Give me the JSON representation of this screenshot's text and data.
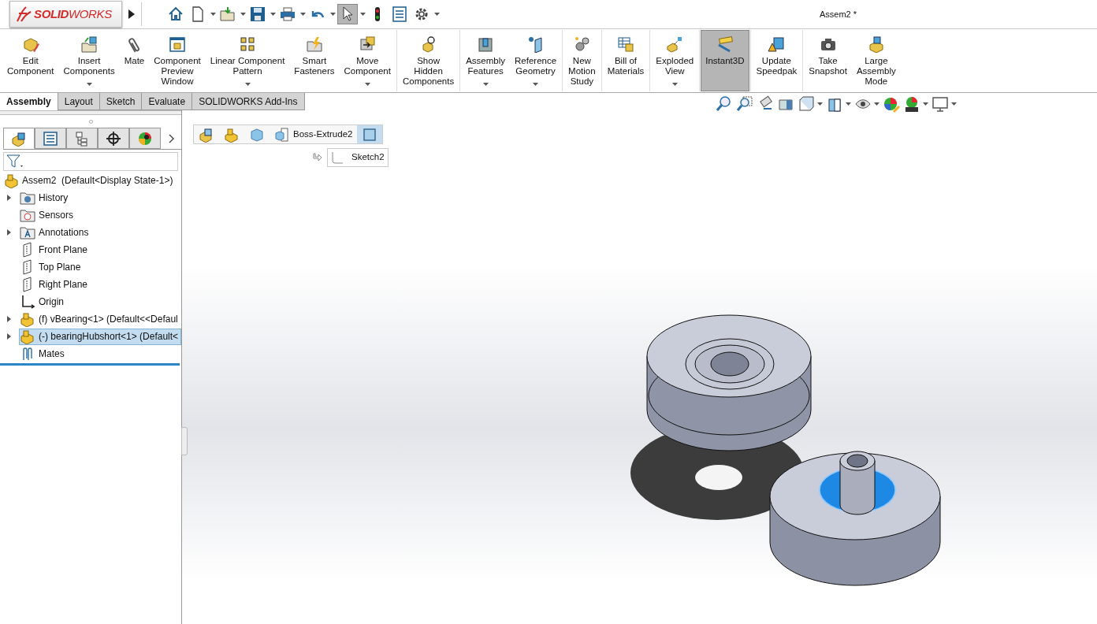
{
  "app": {
    "logo": "**SOLID**WORKS",
    "title": "Assem2 *"
  },
  "quick_tools": [
    {
      "kind": "home",
      "has_menu": false,
      "selected": false
    },
    {
      "kind": "new",
      "has_menu": true,
      "selected": false
    },
    {
      "kind": "open",
      "has_menu": true,
      "selected": false
    },
    {
      "kind": "save",
      "has_menu": true,
      "selected": false
    },
    {
      "kind": "print",
      "has_menu": true,
      "selected": false
    },
    {
      "kind": "undo",
      "has_menu": true,
      "selected": false
    },
    {
      "kind": "select",
      "has_menu": true,
      "selected": true
    },
    {
      "kind": "rebuild",
      "has_menu": false,
      "selected": false
    },
    {
      "kind": "file-properties",
      "has_menu": false,
      "selected": false
    },
    {
      "kind": "options",
      "has_menu": true,
      "selected": false
    }
  ],
  "ribbon": {
    "groups": [
      [
        {
          "label": "Edit\nComponent",
          "kind": "edit",
          "has_menu": false,
          "selected": false
        },
        {
          "label": "Insert\nComponents",
          "kind": "insert",
          "has_menu": true,
          "selected": false
        },
        {
          "label": "Mate",
          "kind": "mate",
          "has_menu": false,
          "selected": false
        },
        {
          "label": "Component\nPreview\nWindow",
          "kind": "preview",
          "has_menu": false,
          "selected": false
        },
        {
          "label": "Linear Component\nPattern",
          "kind": "pattern",
          "has_menu": true,
          "selected": false
        },
        {
          "label": "Smart\nFasteners",
          "kind": "fastener",
          "has_menu": false,
          "selected": false
        },
        {
          "label": "Move\nComponent",
          "kind": "move",
          "has_menu": true,
          "selected": false
        }
      ],
      [
        {
          "label": "Show\nHidden\nComponents",
          "kind": "show",
          "has_menu": false,
          "selected": false
        }
      ],
      [
        {
          "label": "Assembly\nFeatures",
          "kind": "feature",
          "has_menu": true,
          "selected": false
        },
        {
          "label": "Reference\nGeometry",
          "kind": "reference",
          "has_menu": true,
          "selected": false
        }
      ],
      [
        {
          "label": "New\nMotion\nStudy",
          "kind": "motion",
          "has_menu": false,
          "selected": false
        }
      ],
      [
        {
          "label": "Bill of\nMaterials",
          "kind": "bom",
          "has_menu": false,
          "selected": false
        }
      ],
      [
        {
          "label": "Exploded\nView",
          "kind": "explode",
          "has_menu": true,
          "selected": false
        }
      ],
      [
        {
          "label": "Instant3D",
          "kind": "instant3d",
          "has_menu": false,
          "selected": true
        }
      ],
      [
        {
          "label": "Update\nSpeedpak",
          "kind": "speedpak",
          "has_menu": false,
          "selected": false
        }
      ],
      [
        {
          "label": "Take\nSnapshot",
          "kind": "camera",
          "has_menu": false,
          "selected": false
        },
        {
          "label": "Large\nAssembly\nMode",
          "kind": "large",
          "has_menu": false,
          "selected": false
        }
      ]
    ]
  },
  "tabs": [
    {
      "label": "Assembly",
      "selected": true
    },
    {
      "label": "Layout",
      "selected": false
    },
    {
      "label": "Sketch",
      "selected": false
    },
    {
      "label": "Evaluate",
      "selected": false
    },
    {
      "label": "SOLIDWORKS Add-Ins",
      "selected": false
    }
  ],
  "view_tools": [
    {
      "kind": "zoom-fit",
      "has_menu": false
    },
    {
      "kind": "zoom-area",
      "has_menu": false
    },
    {
      "kind": "previous-view",
      "has_menu": false
    },
    {
      "kind": "section",
      "has_menu": false
    },
    {
      "kind": "view-orientation",
      "has_menu": true
    },
    {
      "kind": "display-style",
      "has_menu": true
    },
    {
      "kind": "hide-show",
      "has_menu": true
    },
    {
      "kind": "edit-appearance",
      "has_menu": false
    },
    {
      "kind": "scene",
      "has_menu": true
    },
    {
      "kind": "display",
      "has_menu": true
    }
  ],
  "panel_tabs": [
    {
      "kind": "tree",
      "selected": true
    },
    {
      "kind": "properties",
      "selected": false
    },
    {
      "kind": "config",
      "selected": false
    },
    {
      "kind": "dimxpert",
      "selected": false
    },
    {
      "kind": "appearance",
      "selected": false
    }
  ],
  "tree": {
    "root": {
      "label": "Assem2  (Default<Display State-1>)"
    },
    "items": [
      {
        "label": "History",
        "kind": "history",
        "expandable": true,
        "selected": false
      },
      {
        "label": "Sensors",
        "kind": "sensors",
        "expandable": false,
        "selected": false
      },
      {
        "label": "Annotations",
        "kind": "annotations",
        "expandable": true,
        "selected": false
      },
      {
        "label": "Front Plane",
        "kind": "plane",
        "expandable": false,
        "selected": false
      },
      {
        "label": "Top Plane",
        "kind": "plane",
        "expandable": false,
        "selected": false
      },
      {
        "label": "Right Plane",
        "kind": "plane",
        "expandable": false,
        "selected": false
      },
      {
        "label": "Origin",
        "kind": "origin",
        "expandable": false,
        "selected": false
      },
      {
        "label": "(f) vBearing<1> (Default<<Defaul",
        "kind": "part",
        "expandable": true,
        "selected": false
      },
      {
        "label": "(-) bearingHubshort<1> (Default<",
        "kind": "part",
        "expandable": true,
        "selected": true
      },
      {
        "label": "Mates",
        "kind": "mates",
        "expandable": false,
        "selected": false
      }
    ]
  },
  "breadcrumb": {
    "items": [
      {
        "kind": "assembly",
        "selected": false
      },
      {
        "kind": "part",
        "selected": false
      },
      {
        "kind": "body",
        "selected": false
      },
      {
        "kind": "feature",
        "label": "Boss-Extrude2",
        "selected": false
      },
      {
        "kind": "face",
        "selected": true
      }
    ],
    "sketch": "Sketch2"
  }
}
